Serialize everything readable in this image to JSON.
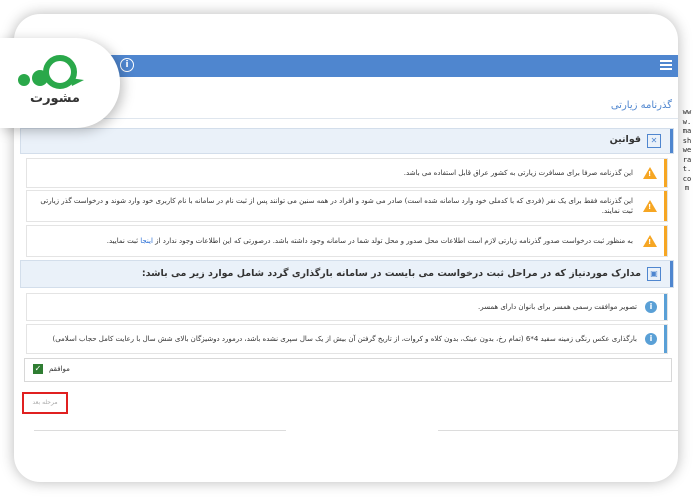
{
  "logo": {
    "text": "مشورت"
  },
  "watermark": {
    "url": "www.mashwerat.com"
  },
  "page_title": "گذرنامه زیارتی",
  "rules_section": {
    "title": "قوانین"
  },
  "warnings": [
    {
      "text": "این گذرنامه صرفا برای مسافرت زیارتی به کشور عراق قابل استفاده می باشد."
    },
    {
      "text": "این گذرنامه فقط برای یک نفر (فردی که با کدملی خود وارد سامانه شده است) صادر می شود و افراد در همه سنین می توانند پس از ثبت نام در سامانه با نام کاربری خود وارد شوند و درخواست گذر زیارتی ثبت نمایند."
    },
    {
      "text_before": "به منظور ثبت درخواست صدور گذرنامه زیارتی لازم است اطلاعات محل صدور و محل تولد شما در سامانه وجود داشته باشد. درصورتی که این اطلاعات وجود ندارد از",
      "link": "اینجا",
      "text_after": "ثبت نمایید."
    }
  ],
  "documents_section": {
    "title": "مدارک موردنیاز که در مراحل ثبت درخواست می بایست در سامانه بارگذاری گردد شامل موارد زیر می باشد:"
  },
  "documents": [
    {
      "text": "تصویر موافقت رسمی همسر برای بانوان دارای همسر."
    },
    {
      "text": "بارگذاری عکس رنگی زمینه سفید 4*6 (تمام رخ، بدون عینک، بدون کلاه و کروات، از تاریخ گرفتن آن بیش از یک سال سپری نشده باشد، درمورد دوشیزگان بالای شش سال با رعایت کامل حجاب اسلامی)"
    }
  ],
  "agree": {
    "label": "موافقم",
    "checked": true
  },
  "next_button": {
    "label": "مرحله بعد"
  }
}
